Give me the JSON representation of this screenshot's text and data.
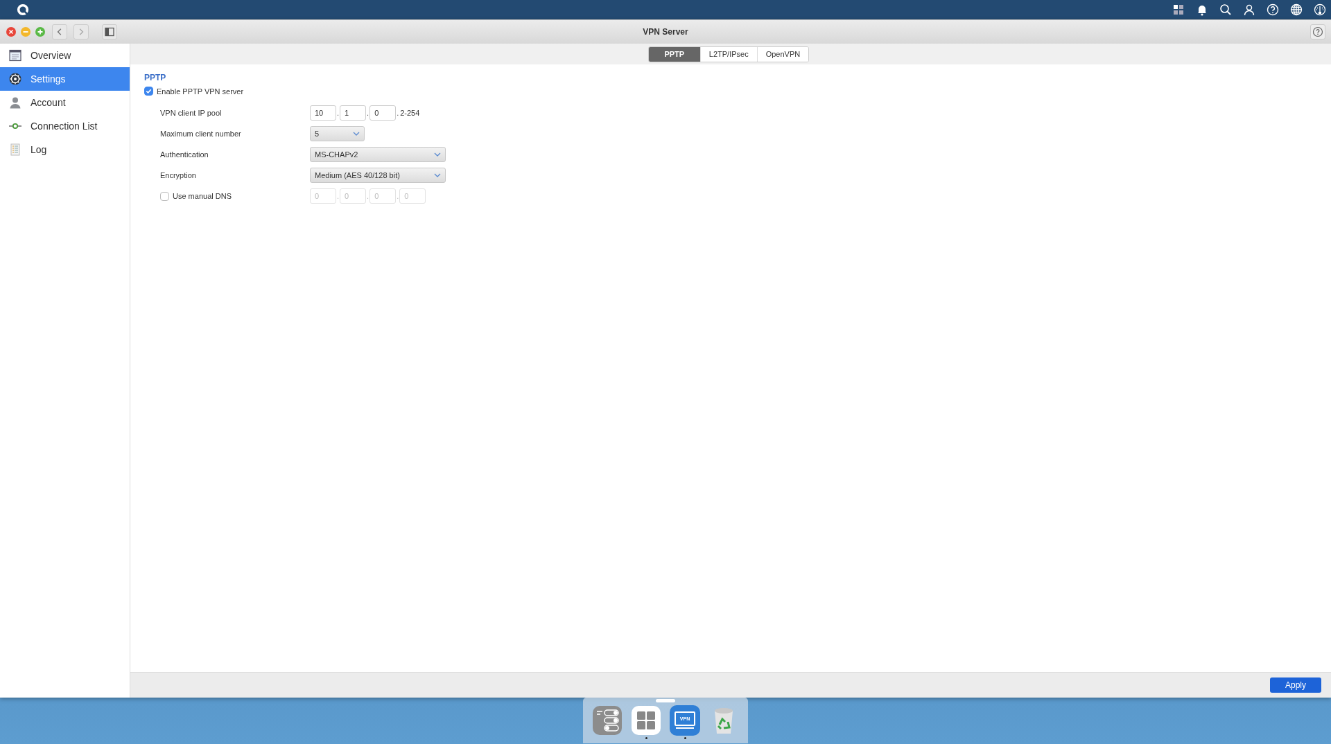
{
  "window": {
    "title": "VPN Server"
  },
  "sidebar": {
    "items": [
      {
        "kind": "overview",
        "label": "Overview",
        "selected": false
      },
      {
        "kind": "settings",
        "label": "Settings",
        "selected": true
      },
      {
        "kind": "account",
        "label": "Account",
        "selected": false
      },
      {
        "kind": "connections",
        "label": "Connection List",
        "selected": false
      },
      {
        "kind": "log",
        "label": "Log",
        "selected": false
      }
    ]
  },
  "tabs": [
    {
      "label": "PPTP",
      "selected": true
    },
    {
      "label": "L2TP/IPsec",
      "selected": false
    },
    {
      "label": "OpenVPN",
      "selected": false
    }
  ],
  "section": {
    "title": "PPTP"
  },
  "enable": {
    "label": "Enable PPTP VPN server",
    "checked": true
  },
  "fields": [
    {
      "kind": "ip",
      "label": "VPN client IP pool",
      "separator": ".",
      "octets": [
        "10",
        "1",
        "0"
      ],
      "suffix": "2-254"
    },
    {
      "kind": "select",
      "label": "Maximum client number",
      "value": "5"
    },
    {
      "kind": "select",
      "label": "Authentication",
      "value": "MS-CHAPv2"
    },
    {
      "kind": "select",
      "label": "Encryption",
      "value": "Medium (AES 40/128 bit)"
    },
    {
      "kind": "dns",
      "label": "Use manual DNS",
      "checked": false,
      "separator": ".",
      "octets": [
        "0",
        "0",
        "0",
        "0"
      ]
    }
  ],
  "apply_button": "Apply",
  "dock": {
    "items": [
      {
        "kind": "storage",
        "running": false
      },
      {
        "kind": "apps",
        "running": true
      },
      {
        "kind": "vpn",
        "label": "VPN",
        "running": true
      },
      {
        "kind": "trash",
        "running": false
      }
    ]
  }
}
